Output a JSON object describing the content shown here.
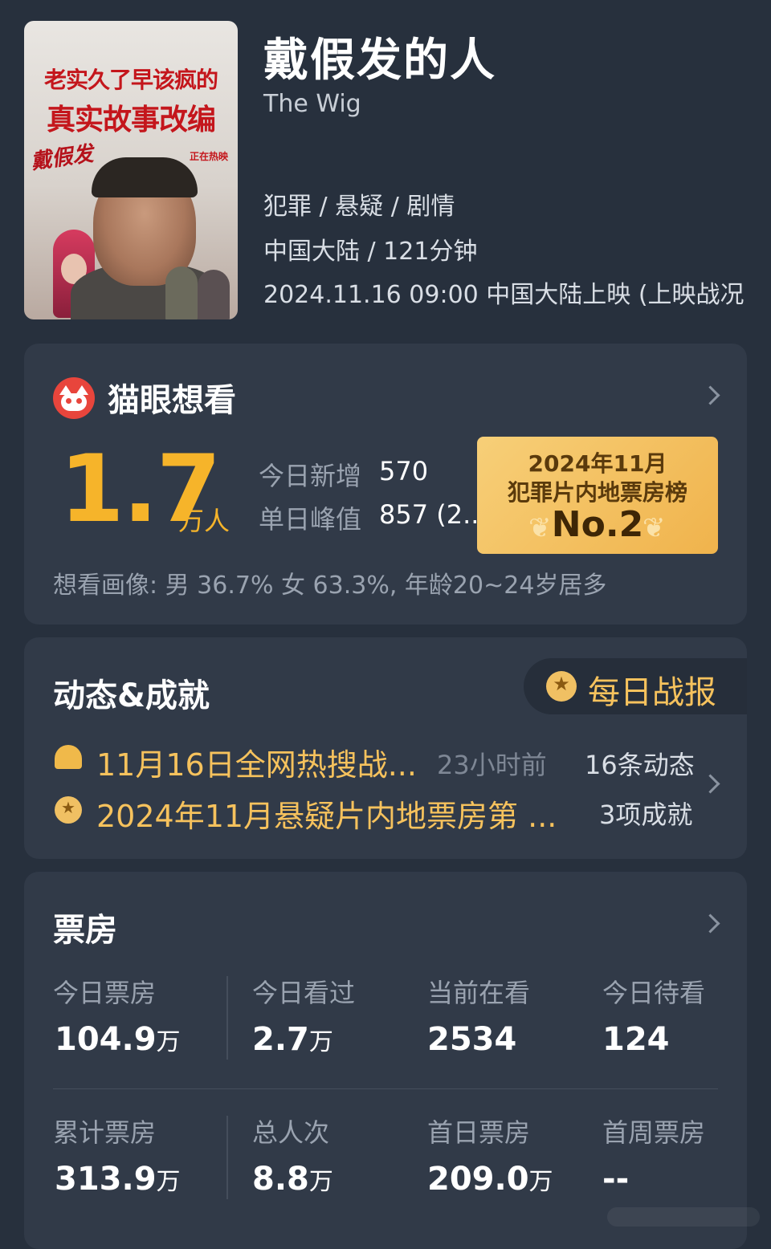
{
  "movie": {
    "title_cn": "戴假发的人",
    "title_en": "The Wig",
    "genres": "犯罪 / 悬疑 / 剧情",
    "region_duration": "中国大陆 / 121分钟",
    "release": "2024.11.16 09:00 中国大陆上映 (上映战况",
    "poster": {
      "line1": "老实久了早该疯的",
      "line2": "真实故事改编",
      "brush_title": "戴假发",
      "tag": "正在热映"
    }
  },
  "want": {
    "title": "猫眼想看",
    "value": "1.7",
    "unit": "万人",
    "new_label": "今日新增",
    "new_value": "570",
    "peak_label": "单日峰值",
    "peak_value": "857 (2...",
    "rank": {
      "line1": "2024年11月",
      "line2": "犯罪片内地票房榜",
      "line3": "No.2"
    },
    "portrait": "想看画像: 男 36.7%  女 63.3%, 年龄20~24岁居多"
  },
  "news": {
    "title": "动态&成就",
    "daily_label": "每日战报",
    "items": [
      {
        "icon": "bell-icon",
        "text": "11月16日全网热搜战...",
        "time": "23小时前",
        "count": "16条动态"
      },
      {
        "icon": "medal-icon",
        "text": "2024年11月悬疑片内地票房第 ...",
        "time": "",
        "count": "3项成就"
      }
    ]
  },
  "box_office": {
    "title": "票房",
    "row1": [
      {
        "label": "今日票房",
        "value": "104.9",
        "unit": "万"
      },
      {
        "label": "今日看过",
        "value": "2.7",
        "unit": "万"
      },
      {
        "label": "当前在看",
        "value": "2534",
        "unit": ""
      },
      {
        "label": "今日待看",
        "value": "124",
        "unit": ""
      }
    ],
    "row2": [
      {
        "label": "累计票房",
        "value": "313.9",
        "unit": "万"
      },
      {
        "label": "总人次",
        "value": "8.8",
        "unit": "万"
      },
      {
        "label": "首日票房",
        "value": "209.0",
        "unit": "万"
      },
      {
        "label": "首周票房",
        "value": "--",
        "unit": ""
      }
    ]
  },
  "colors": {
    "accent": "#f6b42a",
    "background": "#27303d",
    "card": "#313a48"
  }
}
